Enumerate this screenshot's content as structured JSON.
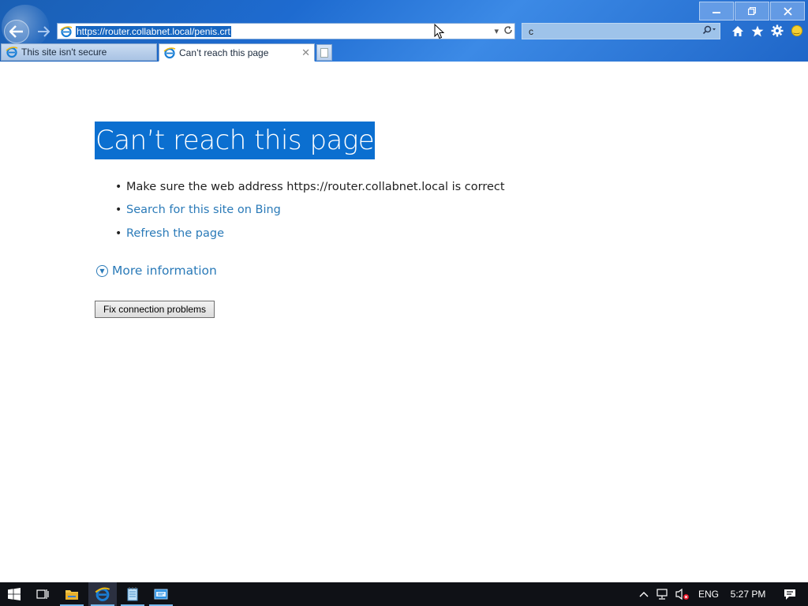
{
  "browser": {
    "address": {
      "url": "https://router.collabnet.local/penis.crt"
    },
    "search": {
      "query": "c"
    },
    "tabs": [
      {
        "label": "This site isn't secure",
        "active": false
      },
      {
        "label": "Can’t reach this page",
        "active": true
      }
    ],
    "window_controls": {
      "minimize": "–",
      "restore": "❐",
      "close": "✕"
    },
    "command_icons": [
      "home-icon",
      "favorites-star-icon",
      "settings-gear-icon",
      "feedback-smiley-icon"
    ]
  },
  "error_page": {
    "title": "Can’t reach this page",
    "items": [
      {
        "text": "Make sure the web address https://router.collabnet.local is correct",
        "link": false
      },
      {
        "text": "Search for this site on Bing",
        "link": true
      },
      {
        "text": "Refresh the page",
        "link": true
      }
    ],
    "more_information": "More information",
    "fix_button": "Fix connection problems"
  },
  "taskbar": {
    "items": [
      "start-icon",
      "task-view-icon",
      "file-explorer-icon",
      "internet-explorer-icon",
      "notepad-icon",
      "app-window-icon"
    ],
    "tray": {
      "language": "ENG",
      "time": "5:27 PM"
    }
  },
  "colors": {
    "chrome_blue": "#1e6bd0",
    "selection_blue": "#0b6fd0",
    "link_blue": "#2a7ab8",
    "taskbar": "#0f1116"
  }
}
